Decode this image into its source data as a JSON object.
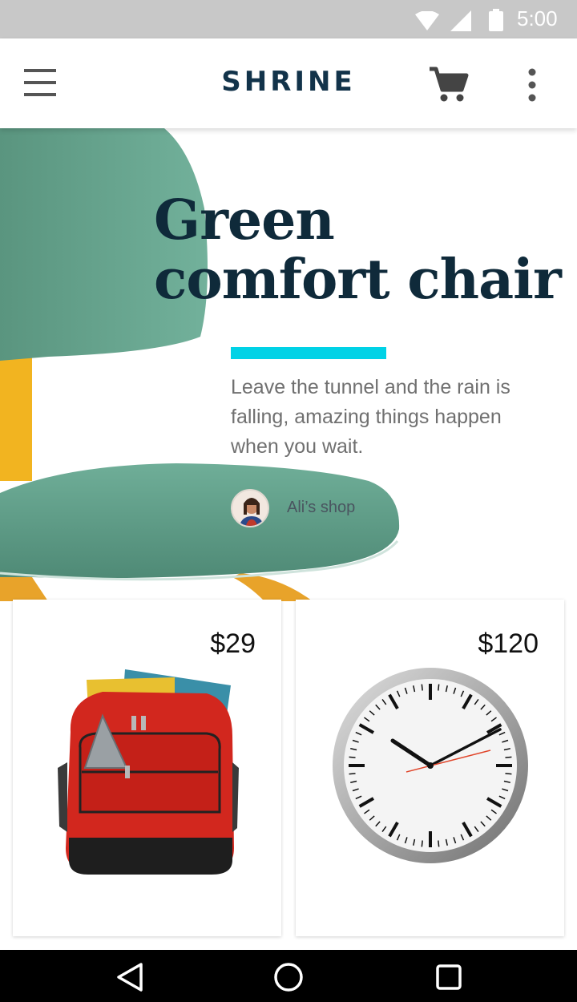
{
  "status_bar": {
    "time": "5:00"
  },
  "app_bar": {
    "title": "SHRINE"
  },
  "hero": {
    "title_line1": "Green",
    "title_line2": "comfort chair",
    "description": "Leave the tunnel and the rain is falling, amazing things happen when you wait.",
    "shop_name": "Ali’s shop"
  },
  "products": [
    {
      "price": "$29",
      "icon": "backpack-image"
    },
    {
      "price": "$120",
      "icon": "wall-clock-image"
    }
  ],
  "nav_bar": {
    "icons": [
      "back-icon",
      "home-icon",
      "recent-apps-icon"
    ]
  },
  "colors": {
    "accent": "#00d2e6",
    "title": "#12334a",
    "status_bar": "#c8c8c8",
    "chair": "#5f9e8a"
  }
}
